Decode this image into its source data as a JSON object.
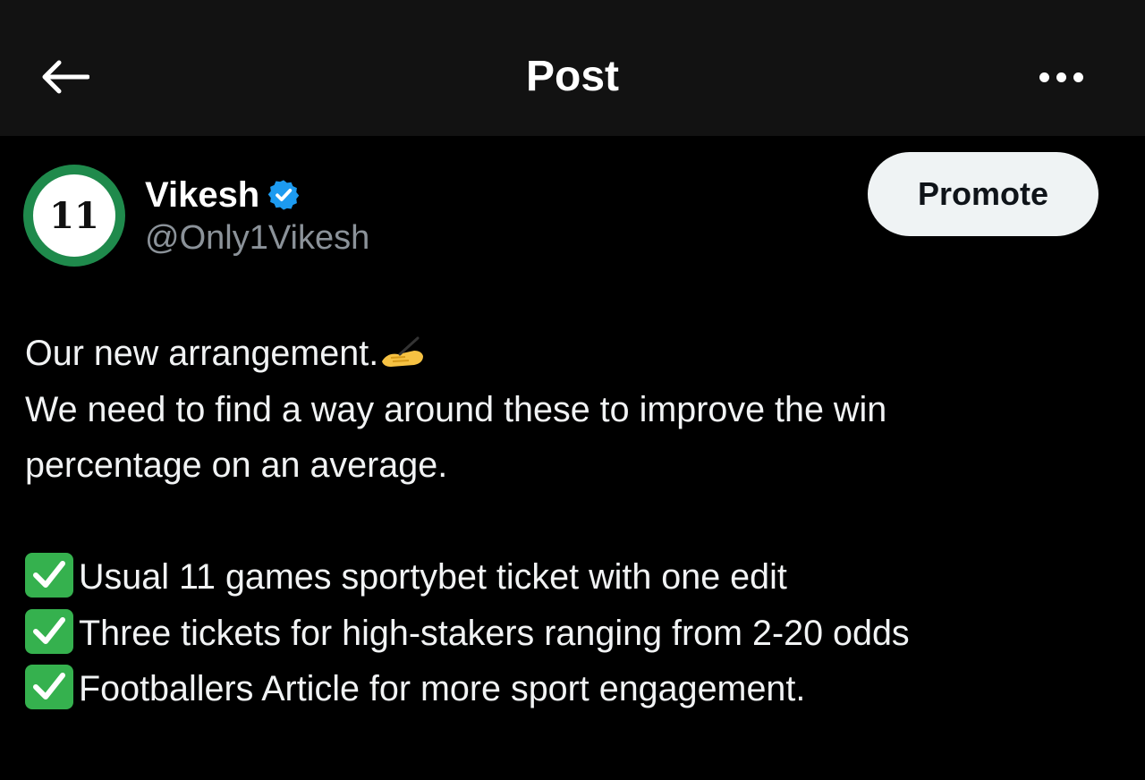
{
  "header": {
    "title": "Post",
    "back_icon": "arrow-left-icon",
    "more_icon": "more-horizontal-icon"
  },
  "post": {
    "avatar_text": "11",
    "author_name": "Vikesh",
    "handle": "@Only1Vikesh",
    "verified": true,
    "promote_label": "Promote",
    "lines": [
      "Our new arrangement.",
      "We need to find a way around these to improve the win",
      "percentage on an average."
    ],
    "items": [
      "Usual 11 games sportybet ticket with one edit",
      "Three tickets for high-stakers ranging from 2-20 odds",
      "Footballers Article for more sport engagement."
    ]
  },
  "colors": {
    "background": "#000000",
    "header_bg": "#121212",
    "verified_blue": "#1d9bf0",
    "check_green": "#35b14e",
    "avatar_ring": "#1f8a4c"
  }
}
